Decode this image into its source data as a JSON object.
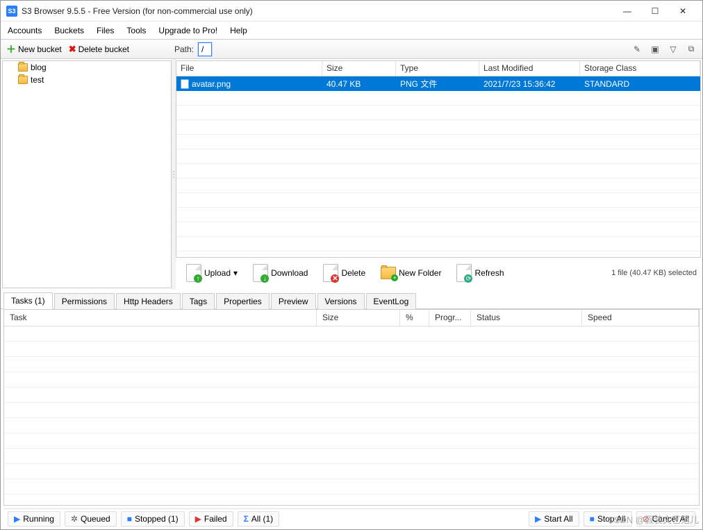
{
  "title": "S3 Browser 9.5.5 - Free Version (for non-commercial use only)",
  "menubar": [
    "Accounts",
    "Buckets",
    "Files",
    "Tools",
    "Upgrade to Pro!",
    "Help"
  ],
  "bucket_tools": {
    "new": "New bucket",
    "delete": "Delete bucket"
  },
  "path": {
    "label": "Path:",
    "value": "/"
  },
  "buckets": [
    {
      "name": "blog"
    },
    {
      "name": "test"
    }
  ],
  "file_columns": {
    "file": "File",
    "size": "Size",
    "type": "Type",
    "modified": "Last Modified",
    "storage": "Storage Class"
  },
  "files": [
    {
      "name": "avatar.png",
      "size": "40.47 KB",
      "type": "PNG 文件",
      "modified": "2021/7/23 15:36:42",
      "storage": "STANDARD",
      "selected": true
    }
  ],
  "file_toolbar": {
    "upload": "Upload",
    "download": "Download",
    "delete": "Delete",
    "newfolder": "New Folder",
    "refresh": "Refresh"
  },
  "file_status": "1 file (40.47 KB) selected",
  "tabs": [
    "Tasks (1)",
    "Permissions",
    "Http Headers",
    "Tags",
    "Properties",
    "Preview",
    "Versions",
    "EventLog"
  ],
  "task_columns": {
    "task": "Task",
    "size": "Size",
    "pct": "%",
    "progr": "Progr...",
    "status": "Status",
    "speed": "Speed"
  },
  "bottom": {
    "running": "Running",
    "queued": "Queued",
    "stopped": "Stopped (1)",
    "failed": "Failed",
    "all": "All (1)",
    "startall": "Start All",
    "stopall": "Stop All",
    "cancelall": "Cancel All"
  },
  "watermark": "CSDN @假装文艺范儿"
}
